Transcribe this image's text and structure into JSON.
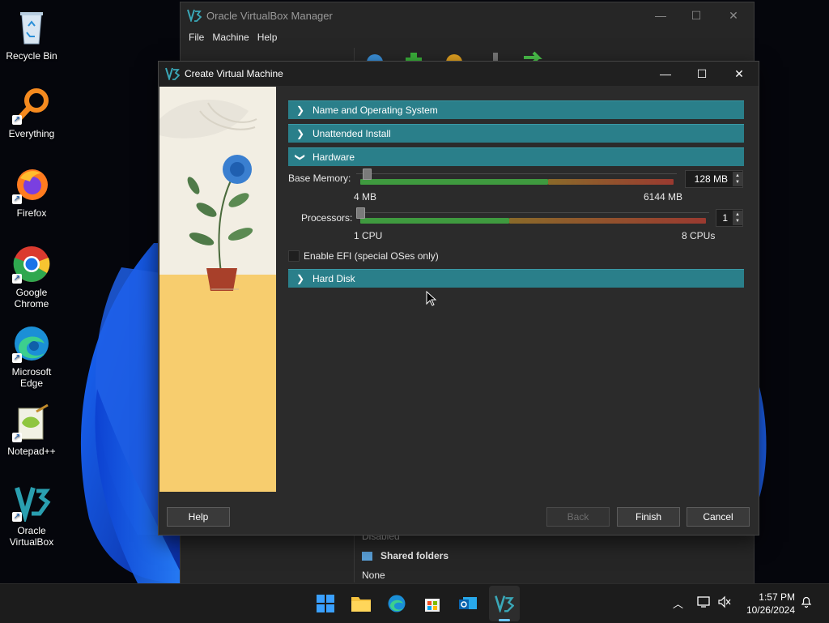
{
  "desktop": {
    "icons": [
      {
        "label": "Recycle Bin",
        "icon": "recycle-bin-icon"
      },
      {
        "label": "Everything",
        "icon": "everything-search-icon"
      },
      {
        "label": "Firefox",
        "icon": "firefox-icon"
      },
      {
        "label": "Google Chrome",
        "icon": "chrome-icon"
      },
      {
        "label": "Microsoft Edge",
        "icon": "edge-icon"
      },
      {
        "label": "Notepad++",
        "icon": "notepadpp-icon"
      },
      {
        "label": "Oracle VirtualBox",
        "icon": "virtualbox-icon"
      }
    ]
  },
  "manager": {
    "title": "Oracle VirtualBox Manager",
    "menu": [
      "File",
      "Machine",
      "Help"
    ],
    "details": {
      "disabled_text": "Disabled",
      "shared_folders_label": "Shared folders",
      "shared_folders_value": "None"
    }
  },
  "dialog": {
    "title": "Create Virtual Machine",
    "sections": [
      {
        "label": "Name and Operating System",
        "expanded": false
      },
      {
        "label": "Unattended Install",
        "expanded": false
      },
      {
        "label": "Hardware",
        "expanded": true
      },
      {
        "label": "Hard Disk",
        "expanded": false
      }
    ],
    "hardware": {
      "base_memory_label": "Base Memory:",
      "base_memory_value": "128 MB",
      "memory_min": "4 MB",
      "memory_max": "6144 MB",
      "processors_label": "Processors:",
      "processors_value": "1",
      "cpu_min": "1 CPU",
      "cpu_max": "8 CPUs",
      "efi_label": "Enable EFI (special OSes only)",
      "efi_checked": false
    },
    "buttons": {
      "help": "Help",
      "back": "Back",
      "finish": "Finish",
      "cancel": "Cancel"
    }
  },
  "taskbar": {
    "time": "1:57 PM",
    "date": "10/26/2024"
  },
  "colors": {
    "section_header": "#2a7f8a",
    "slider_green": "#3f9a3f",
    "slider_red": "#9a3a30"
  }
}
